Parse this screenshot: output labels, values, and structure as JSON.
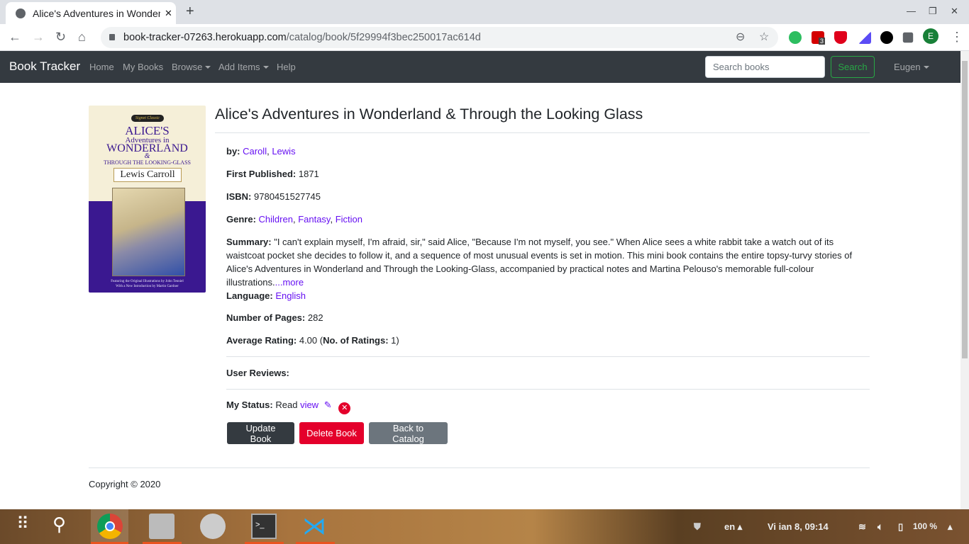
{
  "browser": {
    "tab_title": "Alice's Adventures in Wonderland & Through the Looking Glass",
    "url_host": "book-tracker-07263.herokuapp.com",
    "url_path": "/catalog/book/5f29994f3bec250017ac614d",
    "ext_badge": "3",
    "profile_initial": "E"
  },
  "navbar": {
    "brand": "Book Tracker",
    "links": [
      "Home",
      "My Books",
      "Browse",
      "Add Items",
      "Help"
    ],
    "search_placeholder": "Search books",
    "search_label": "Search",
    "user": "Eugen"
  },
  "cover": {
    "series": "Signet Classic",
    "line1": "ALICE'S",
    "line2": "Adventures in",
    "line3": "WONDERLAND",
    "amp": "&",
    "line4": "THROUGH THE LOOKING-GLASS",
    "author": "Lewis Carroll",
    "footer1": "Featuring the Original Illustrations by John Tenniel",
    "footer2": "With a New Introduction by Martin Gardner"
  },
  "book": {
    "title": "Alice's Adventures in Wonderland & Through the Looking Glass",
    "by_label": "by:",
    "authors": [
      "Caroll",
      "Lewis"
    ],
    "first_published_label": "First Published:",
    "first_published": "1871",
    "isbn_label": "ISBN:",
    "isbn": "9780451527745",
    "genre_label": "Genre:",
    "genres": [
      "Children",
      "Fantasy",
      "Fiction"
    ],
    "summary_label": "Summary:",
    "summary": "\"I can't explain myself, I'm afraid, sir,\" said Alice, \"Because I'm not myself, you see.\" When Alice sees a white rabbit take a watch out of its waistcoat pocket she decides to follow it, and a sequence of most unusual events is set in motion. This mini book contains the entire topsy-turvy stories of Alice's Adventures in Wonderland and Through the Looking-Glass, accompanied by practical notes and Martina Pelouso's memorable full-colour illustrations.",
    "more": "...more",
    "language_label": "Language:",
    "language": "English",
    "pages_label": "Number of Pages:",
    "pages": "282",
    "rating_label": "Average Rating:",
    "rating": "4.00",
    "num_ratings_label": "No. of Ratings:",
    "num_ratings": "1",
    "reviews_label": "User Reviews:",
    "status_label": "My Status:",
    "status": "Read",
    "status_view": "view"
  },
  "buttons": {
    "update": "Update Book",
    "delete": "Delete Book",
    "back": "Back to Catalog"
  },
  "footer": {
    "copyright": "Copyright © 2020"
  },
  "taskbar": {
    "lang": "en",
    "clock": "Vi ian  8, 09:14",
    "battery": "100 %"
  },
  "colors": {
    "link": "#6610f2",
    "navbar": "#343a40",
    "danger": "#e4002b",
    "secondary": "#6c757d",
    "dark": "#343a40"
  }
}
